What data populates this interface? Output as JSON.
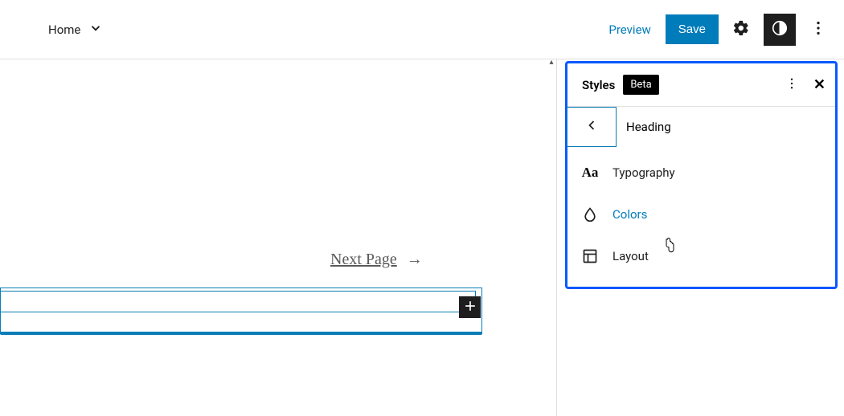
{
  "topbar": {
    "home": "Home",
    "preview": "Preview",
    "save": "Save"
  },
  "canvas": {
    "nextpage": "Next Page"
  },
  "styles": {
    "title": "Styles",
    "badge": "Beta",
    "back_label": "Heading",
    "items": {
      "typography": "Typography",
      "colors": "Colors",
      "layout": "Layout"
    }
  }
}
